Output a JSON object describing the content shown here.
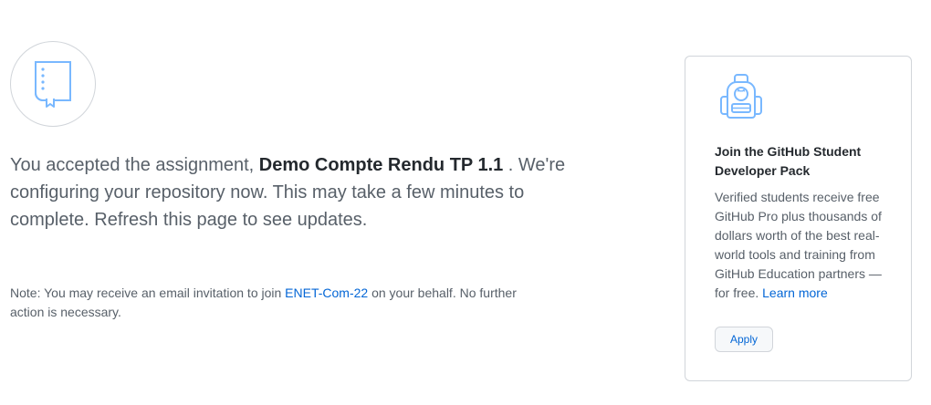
{
  "message": {
    "prefix": "You accepted the assignment, ",
    "assignment_name": "Demo Compte Rendu TP 1.1",
    "suffix": " . We're configuring your repository now. This may take a few minutes to complete. Refresh this page to see updates."
  },
  "note": {
    "prefix": "Note: You may receive an email invitation to join ",
    "org_link": "ENET-Com-22",
    "suffix": " on your behalf. No further action is necessary."
  },
  "student_pack": {
    "title": "Join the GitHub Student Developer Pack",
    "description": "Verified students receive free GitHub Pro plus thousands of dollars worth of the best real-world tools and training from GitHub Education partners — for free. ",
    "learn_more": "Learn more",
    "apply_label": "Apply",
    "icon": "backpack-icon"
  },
  "icons": {
    "repo": "book-icon"
  },
  "colors": {
    "accent": "#0366d6",
    "icon_blue": "#79b8ff",
    "text_muted": "#586069",
    "border": "#d1d5da"
  }
}
